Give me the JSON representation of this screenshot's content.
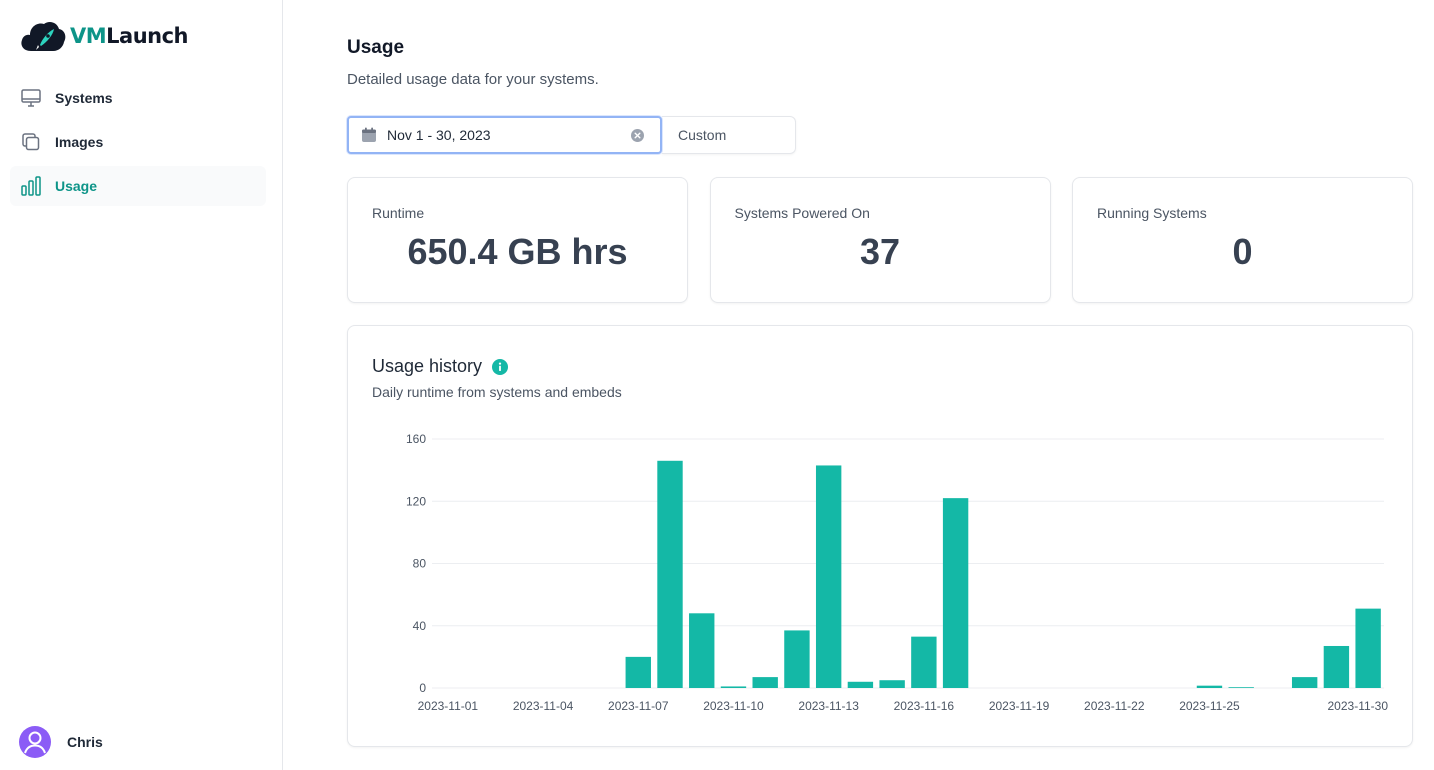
{
  "brand": {
    "name_part1": "VM",
    "name_part2": "Launch",
    "accent": "#0d9488"
  },
  "sidebar": {
    "items": [
      {
        "label": "Systems",
        "icon": "monitor-icon",
        "active": false
      },
      {
        "label": "Images",
        "icon": "copy-icon",
        "active": false
      },
      {
        "label": "Usage",
        "icon": "bar-chart-icon",
        "active": true
      }
    ]
  },
  "user": {
    "name": "Chris",
    "avatar_color": "#8b5cf6"
  },
  "page": {
    "title": "Usage",
    "subtitle": "Detailed usage data for your systems."
  },
  "date_filter": {
    "range": "Nov 1 - 30, 2023",
    "preset": "Custom"
  },
  "stats": [
    {
      "label": "Runtime",
      "value": "650.4 GB hrs"
    },
    {
      "label": "Systems Powered On",
      "value": "37"
    },
    {
      "label": "Running Systems",
      "value": "0"
    }
  ],
  "history": {
    "title": "Usage history",
    "subtitle": "Daily runtime from systems and embeds"
  },
  "chart_data": {
    "type": "bar",
    "categories": [
      "2023-11-01",
      "2023-11-02",
      "2023-11-03",
      "2023-11-04",
      "2023-11-05",
      "2023-11-06",
      "2023-11-07",
      "2023-11-08",
      "2023-11-09",
      "2023-11-10",
      "2023-11-11",
      "2023-11-12",
      "2023-11-13",
      "2023-11-14",
      "2023-11-15",
      "2023-11-16",
      "2023-11-17",
      "2023-11-18",
      "2023-11-19",
      "2023-11-20",
      "2023-11-21",
      "2023-11-22",
      "2023-11-23",
      "2023-11-24",
      "2023-11-25",
      "2023-11-26",
      "2023-11-27",
      "2023-11-28",
      "2023-11-29",
      "2023-11-30"
    ],
    "values": [
      0,
      0,
      0,
      0,
      0,
      0,
      20,
      146,
      48,
      1,
      7,
      37,
      143,
      4,
      5,
      33,
      122,
      0,
      0,
      0,
      0,
      0,
      0,
      0,
      1.5,
      0.5,
      0,
      7,
      27,
      51
    ],
    "x_tick_labels": [
      "2023-11-01",
      "2023-11-04",
      "2023-11-07",
      "2023-11-10",
      "2023-11-13",
      "2023-11-16",
      "2023-11-19",
      "2023-11-22",
      "2023-11-25",
      "2023-11-30"
    ],
    "y_ticks": [
      0,
      40,
      80,
      120,
      160
    ],
    "ylim": [
      0,
      160
    ],
    "grid": true,
    "color": "#14b8a6"
  }
}
